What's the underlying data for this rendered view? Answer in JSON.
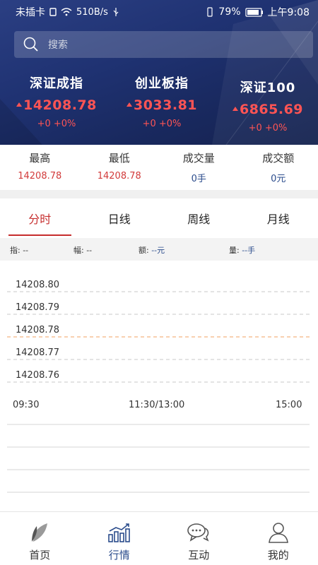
{
  "status_bar": {
    "carrier": "未插卡",
    "speed": "510B/s",
    "battery": "79%",
    "time": "上午9:08"
  },
  "search": {
    "placeholder": "搜索"
  },
  "indices": [
    {
      "name": "深证成指",
      "value": "14208.78",
      "change": "+0 +0%"
    },
    {
      "name": "创业板指",
      "value": "3033.81",
      "change": "+0 +0%"
    },
    {
      "name": "深证100",
      "value": "6865.69",
      "change": "+0 +0%"
    }
  ],
  "stats": [
    {
      "label": "最高",
      "value": "14208.78"
    },
    {
      "label": "最低",
      "value": "14208.78"
    },
    {
      "label": "成交量",
      "value": "0手"
    },
    {
      "label": "成交额",
      "value": "0元"
    }
  ],
  "tabs": [
    "分时",
    "日线",
    "周线",
    "月线"
  ],
  "info": {
    "zhi": "指: --",
    "fu": "幅: --",
    "e_label": "额: ",
    "e_value": "--元",
    "liang_label": "量: ",
    "liang_value": "--手"
  },
  "chart_data": {
    "type": "line",
    "y_ticks": [
      "14208.80",
      "14208.79",
      "14208.78",
      "14208.77",
      "14208.76"
    ],
    "x_ticks": [
      "09:30",
      "11:30/13:00",
      "15:00"
    ],
    "reference_value": 14208.78,
    "series": []
  },
  "nav": [
    "首页",
    "行情",
    "互动",
    "我的"
  ],
  "colors": {
    "accent_red": "#d23a3a",
    "accent_blue": "#2b4c8c",
    "header_bg": "#1f3272"
  }
}
